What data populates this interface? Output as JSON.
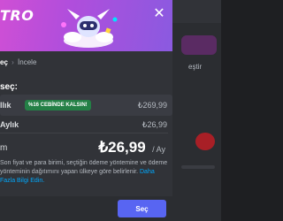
{
  "brand": "TRO",
  "breadcrumb": {
    "step1": "eç",
    "separator": "›",
    "step2": "İncele"
  },
  "section_title": "seç:",
  "plans": {
    "yearly": {
      "name": "llık",
      "badge": "%16 CEBİNDE KALSIN!",
      "price": "₺269,99"
    },
    "monthly": {
      "name": "Aylık",
      "price": "₺26,99"
    }
  },
  "total": {
    "label": "m",
    "amount": "₺26,99",
    "unit": "/ Ay"
  },
  "disclaimer": {
    "text": "Son fiyat ve para birimi, seçtiğin ödeme yöntemine ve ödeme yönteminin dağıtımını yapan ülkeye göre belirlenir.",
    "link": "Daha Fazla Bilgi Edin."
  },
  "footer": {
    "select_label": "Seç"
  },
  "background": {
    "heading_fragment": "eştir"
  },
  "colors": {
    "accent": "#5865f2",
    "badge": "#248046",
    "header_start": "#cf4fd5",
    "header_end": "#8a5ae0"
  },
  "icons": {
    "close": "close-icon",
    "mascot": "mascot-illustration"
  }
}
